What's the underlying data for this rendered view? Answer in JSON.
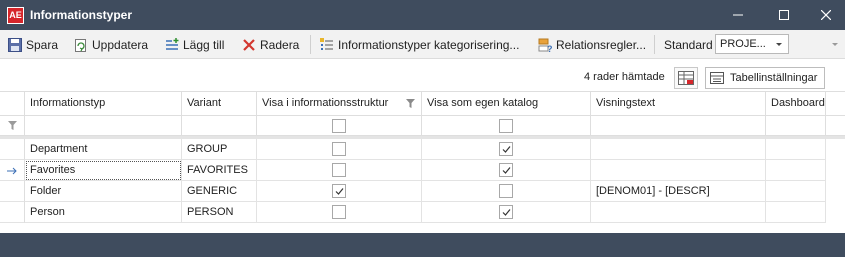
{
  "window": {
    "title": "Informationstyper",
    "app_icon_text": "AE",
    "controls": [
      "minimize-icon",
      "maximize-icon",
      "close-icon"
    ]
  },
  "toolbar": {
    "save_label": "Spara",
    "refresh_label": "Uppdatera",
    "add_label": "Lägg till",
    "delete_label": "Radera",
    "categorize_label": "Informationstyper kategorisering...",
    "relation_rules_label": "Relationsregler...",
    "standard_label": "Standard",
    "standard_select_value": "PROJE..."
  },
  "status": {
    "rows_fetched": "4 rader hämtade",
    "table_settings_label": "Tabellinställningar"
  },
  "grid": {
    "columns": [
      "Informationstyp",
      "Variant",
      "Visa i informationsstruktur",
      "Visa som egen katalog",
      "Visningstext",
      "Dashboard"
    ],
    "rows": [
      {
        "type": "Department",
        "variant": "GROUP",
        "show_in_structure": false,
        "own_catalog": true,
        "display_text": "",
        "dashboard": "",
        "current": false
      },
      {
        "type": "Favorites",
        "variant": "FAVORITES",
        "show_in_structure": false,
        "own_catalog": true,
        "display_text": "",
        "dashboard": "",
        "current": true
      },
      {
        "type": "Folder",
        "variant": "GENERIC",
        "show_in_structure": true,
        "own_catalog": false,
        "display_text": "[DENOM01] - [DESCR]",
        "dashboard": "",
        "current": false
      },
      {
        "type": "Person",
        "variant": "PERSON",
        "show_in_structure": false,
        "own_catalog": true,
        "display_text": "",
        "dashboard": "",
        "current": false
      }
    ]
  },
  "colors": {
    "titlebar": "#3f4c5e",
    "toolbar_bg": "#f2f2f2",
    "brand_red": "#d6262b",
    "row_indicator": "#3b6fb6"
  }
}
